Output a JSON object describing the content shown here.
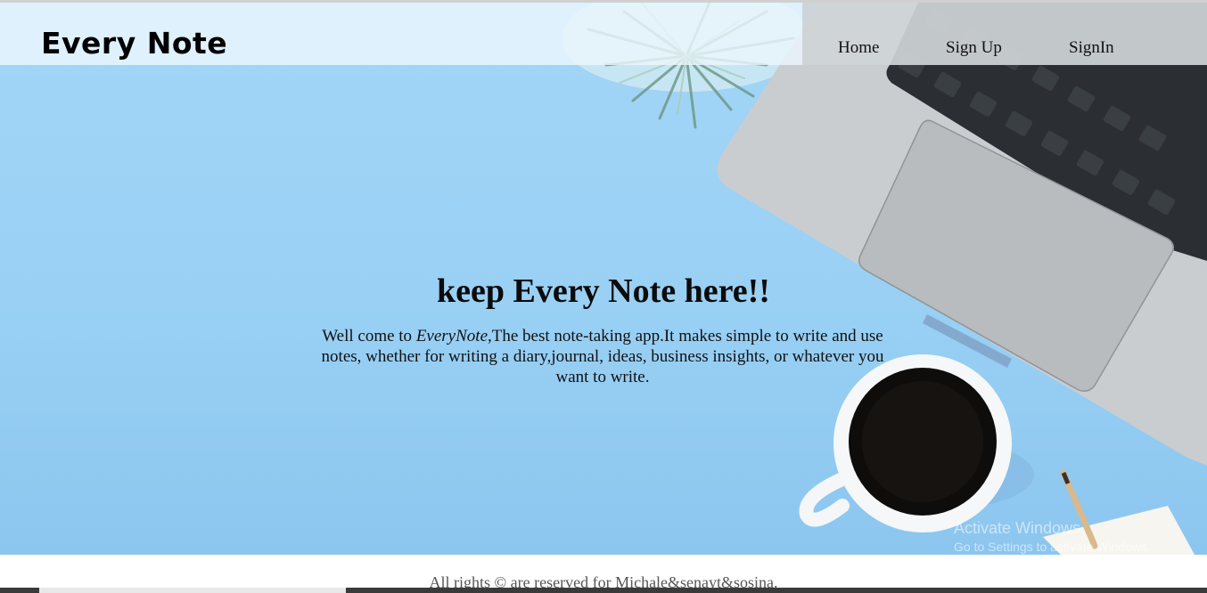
{
  "header": {
    "logo": "Every Note",
    "nav": {
      "home": "Home",
      "sign_up": "Sign Up",
      "sign_in": "SignIn"
    }
  },
  "hero": {
    "headline": "keep Every Note here!!",
    "tagline_before": "Well come to ",
    "tagline_brand": "EveryNote",
    "tagline_after": ",The best note-taking app.It makes simple to write and use notes, whether for writing a diary,journal, ideas, business insights, or whatever you want to write."
  },
  "watermark": {
    "title": "Activate Windows",
    "subtitle": "Go to Settings to activate Windows."
  },
  "footer": {
    "text": "All rights © are reserved for Michale&senayt&sosina."
  },
  "colors": {
    "hero_background": "#9ed3f5",
    "header_background": "#ebf6fd",
    "text": "#111111"
  }
}
